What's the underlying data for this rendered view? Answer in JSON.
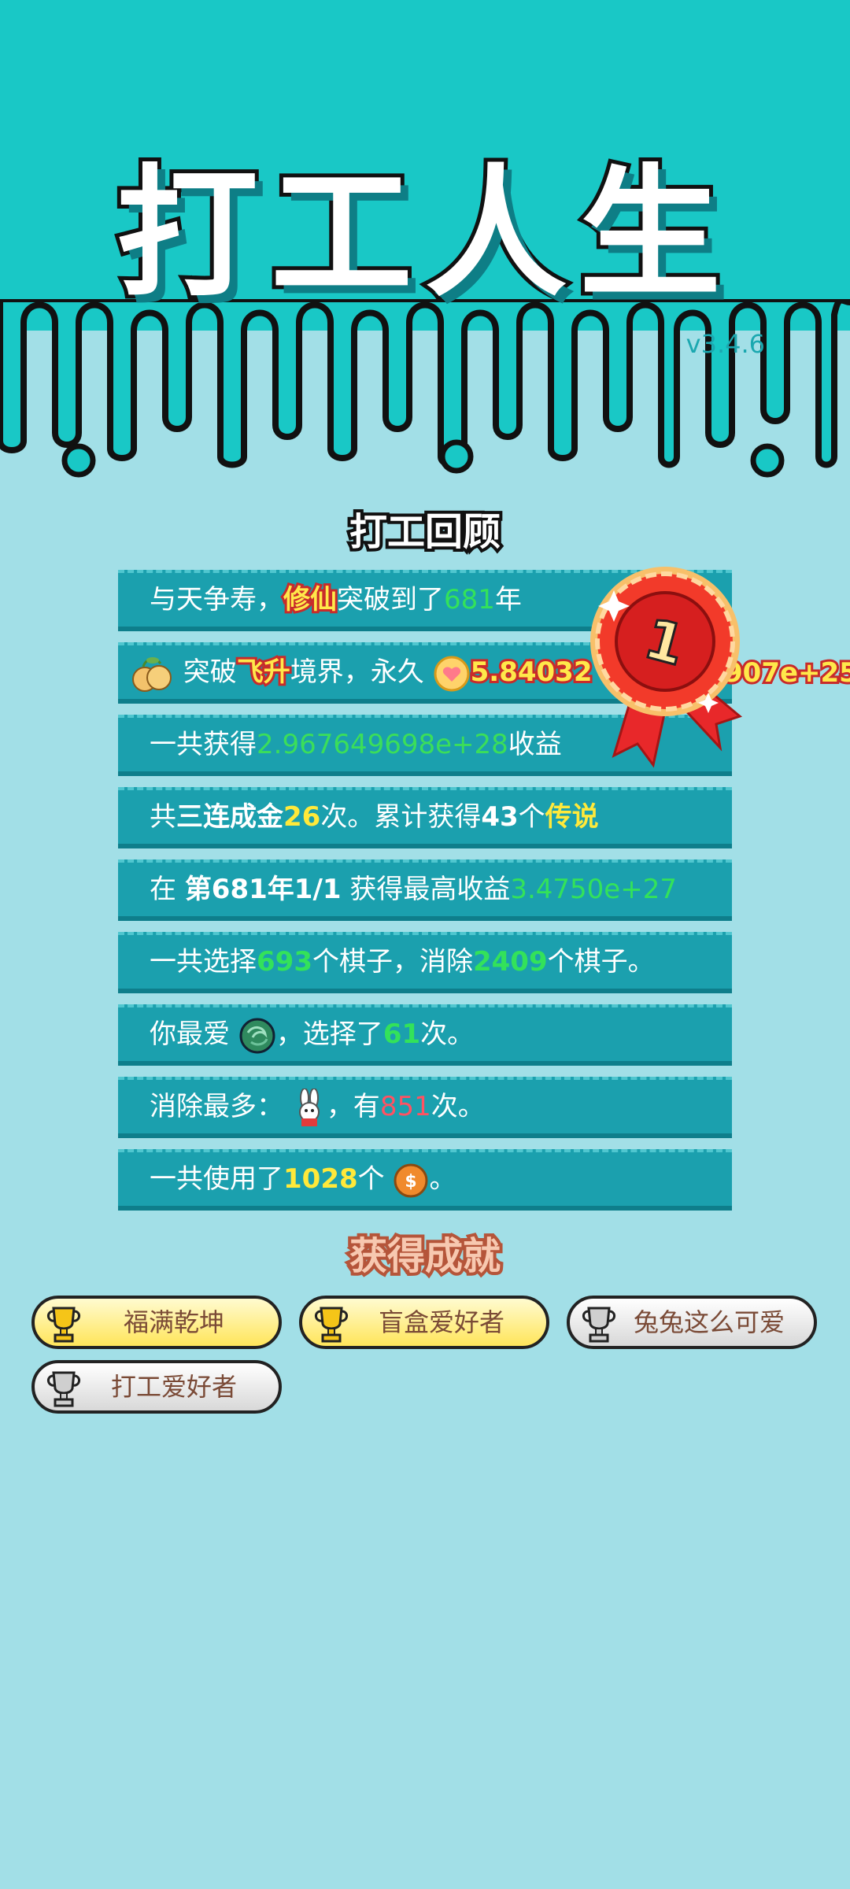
{
  "title": "打工人生",
  "version": "v3.4.6",
  "review": {
    "title": "打工回顾",
    "lifespan": {
      "prefix": "与天争寿，",
      "path": "修仙",
      "mid": "突破到了",
      "years": "681",
      "suffix": "年"
    },
    "ascend": {
      "prefix": "突破",
      "realm": "飞升",
      "mid": "境界，永久",
      "value": "5.84032",
      "value_tail": "907e+25"
    },
    "total_income": {
      "prefix": "一共获得",
      "value": "2.967649698e+28",
      "suffix": "收益"
    },
    "triple": {
      "prefix": "共",
      "bold": "三连成金",
      "count": "26",
      "mid": "次。累计获得",
      "legend_count": "43",
      "unit": "个",
      "legend": "传说"
    },
    "best": {
      "prefix": "在 ",
      "date": "第681年1/1",
      "mid": " 获得最高收益",
      "value": "3.4750e+27"
    },
    "pieces": {
      "prefix": "一共选择",
      "chosen": "693",
      "mid": "个棋子，消除",
      "removed": "2409",
      "suffix": "个棋子。"
    },
    "favorite": {
      "prefix": "你最爱",
      "mid": "，选择了",
      "count": "61",
      "suffix": "次。"
    },
    "most_removed": {
      "prefix": "消除最多：",
      "mid": "，有",
      "count": "851",
      "suffix": "次。"
    },
    "coins": {
      "prefix": "一共使用了",
      "count": "1028",
      "unit": "个",
      "suffix": "。"
    },
    "medal_rank": "1"
  },
  "achievements": {
    "title": "获得成就",
    "items": [
      {
        "label": "福满乾坤",
        "tier": "gold"
      },
      {
        "label": "盲盒爱好者",
        "tier": "gold"
      },
      {
        "label": "兔兔这么可爱",
        "tier": "silver"
      },
      {
        "label": "打工爱好者",
        "tier": "silver"
      }
    ]
  },
  "colors": {
    "header_bg": "#19c8c6",
    "page_bg": "#a2dfe7",
    "row_bg": "#1ba0ae",
    "green": "#33e25a",
    "yellow": "#ffe93a",
    "red": "#ff5262"
  }
}
